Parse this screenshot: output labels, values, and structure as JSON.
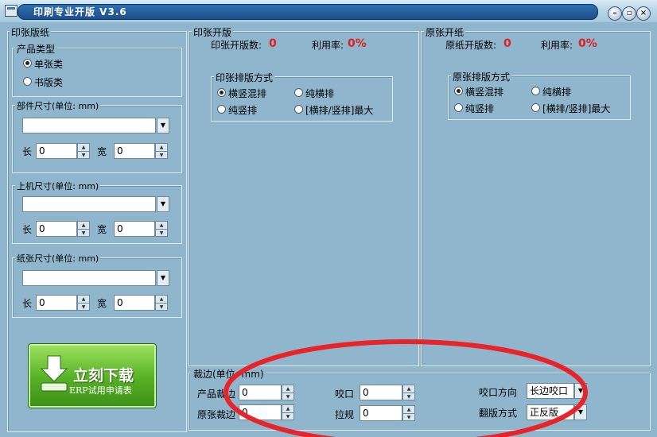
{
  "window": {
    "title": "印刷专业开版 V3.6"
  },
  "left": {
    "paper_group": "印张版纸",
    "product_type": {
      "label": "产品类型",
      "options": [
        "单张类",
        "书版类"
      ]
    },
    "part_size": {
      "label": "部件尺寸(单位: mm)",
      "length_label": "长",
      "length": "0",
      "width_label": "宽",
      "width": "0"
    },
    "machine_size": {
      "label": "上机尺寸(单位: mm)",
      "length_label": "长",
      "length": "0",
      "width_label": "宽",
      "width": "0"
    },
    "paper_size": {
      "label": "纸张尺寸(单位: mm)",
      "length_label": "长",
      "length": "0",
      "width_label": "宽",
      "width": "0"
    },
    "download": {
      "main": "立刻下载",
      "sub": "ERP试用申请表"
    }
  },
  "print_sheet": {
    "title": "印张开版",
    "count_label": "印张开版数:",
    "count": "0",
    "rate_label": "利用率:",
    "rate": "0%",
    "method": {
      "label": "印张排版方式",
      "options": [
        "横竖混排",
        "纯横排",
        "纯竖排",
        "[横排/竖排]最大"
      ]
    }
  },
  "raw_sheet": {
    "title": "原张开纸",
    "count_label": "原纸开版数:",
    "count": "0",
    "rate_label": "利用率:",
    "rate": "0%",
    "method": {
      "label": "原张排版方式",
      "options": [
        "横竖混排",
        "纯横排",
        "纯竖排",
        "[横排/竖排]最大"
      ]
    }
  },
  "trim": {
    "title": "裁边(单位: mm)",
    "product_trim_label": "产品裁边",
    "product_trim": "0",
    "raw_trim_label": "原张裁边",
    "raw_trim": "0",
    "bite_label": "咬口",
    "bite": "0",
    "side_guide_label": "拉规",
    "side_guide": "0",
    "bite_dir_label": "咬口方向",
    "bite_dir": "长边咬口",
    "flip_label": "翻版方式",
    "flip": "正反版"
  }
}
